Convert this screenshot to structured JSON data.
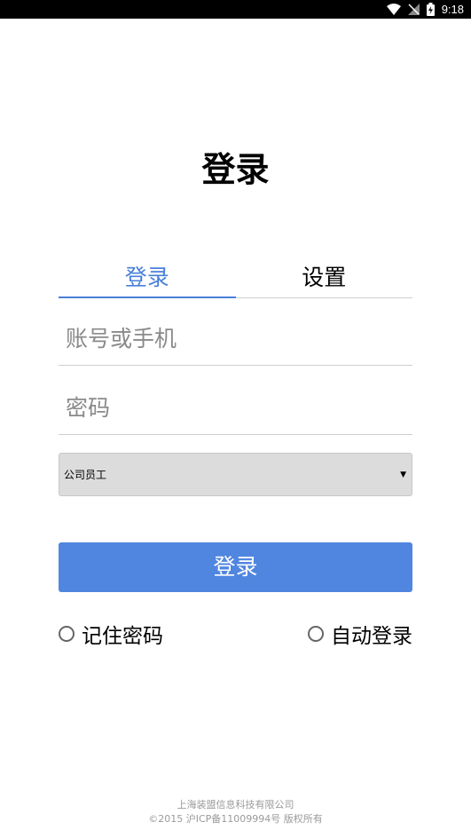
{
  "status_bar": {
    "time": "9:18",
    "icons": [
      "wifi-icon",
      "no-signal-icon",
      "battery-charging-icon"
    ]
  },
  "page": {
    "title": "登录"
  },
  "tabs": [
    {
      "label": "登录",
      "active": true
    },
    {
      "label": "设置",
      "active": false
    }
  ],
  "form": {
    "account_placeholder": "账号或手机",
    "password_placeholder": "密码",
    "role_select_value": "公司员工",
    "login_button_label": "登录"
  },
  "options": {
    "remember_password": "记住密码",
    "auto_login": "自动登录"
  },
  "footer": {
    "company": "上海装盟信息科技有限公司",
    "copyright": "©2015 沪ICP备11009994号 版权所有"
  },
  "colors": {
    "accent": "#4a7fd9",
    "button": "#5086e0",
    "select_bg": "#dcdcdc"
  }
}
